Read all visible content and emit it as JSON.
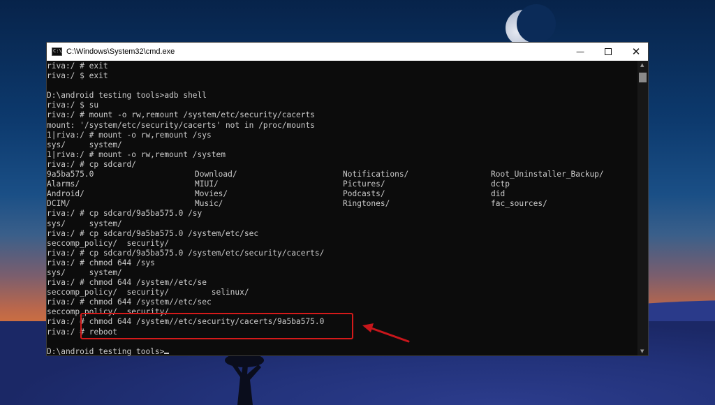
{
  "window": {
    "title": "C:\\Windows\\System32\\cmd.exe",
    "icon_text": "C:\\",
    "buttons": {
      "minimize": "—",
      "close": "✕"
    }
  },
  "console": {
    "lines": [
      "riva:/ # exit",
      "riva:/ $ exit",
      "",
      "D:\\android testing tools>adb shell",
      "riva:/ $ su",
      "riva:/ # mount -o rw,remount /system/etc/security/cacerts",
      "mount: '/system/etc/security/cacerts' not in /proc/mounts",
      "1|riva:/ # mount -o rw,remount /sys",
      "sys/     system/",
      "1|riva:/ # mount -o rw,remount /system",
      "riva:/ # cp sdcard/",
      "",
      "",
      "",
      "",
      "riva:/ # cp sdcard/9a5ba575.0 /sy",
      "sys/     system/",
      "riva:/ # cp sdcard/9a5ba575.0 /system/etc/sec",
      "seccomp_policy/  security/",
      "riva:/ # cp sdcard/9a5ba575.0 /system/etc/security/cacerts/",
      "riva:/ # chmod 644 /sys",
      "sys/     system/",
      "riva:/ # chmod 644 /system//etc/se",
      "seccomp_policy/  security/         selinux/",
      "riva:/ # chmod 644 /system//etc/sec",
      "seccomp_policy/  security/",
      "riva:/ # chmod 644 /system//etc/security/cacerts/9a5ba575.0",
      "riva:/ # reboot",
      "",
      "D:\\android testing tools>"
    ],
    "sdcard_listing": [
      [
        "9a5ba575.0",
        "Download/",
        "Notifications/",
        "Root_Uninstaller_Backup/"
      ],
      [
        "Alarms/",
        "MIUI/",
        "Pictures/",
        "dctp"
      ],
      [
        "Android/",
        "Movies/",
        "Podcasts/",
        "did"
      ],
      [
        "DCIM/",
        "Music/",
        "Ringtones/",
        "fac_sources/"
      ]
    ]
  },
  "colors": {
    "console_bg": "#0c0c0c",
    "console_text": "#cccccc",
    "highlight": "#d51a1a"
  }
}
